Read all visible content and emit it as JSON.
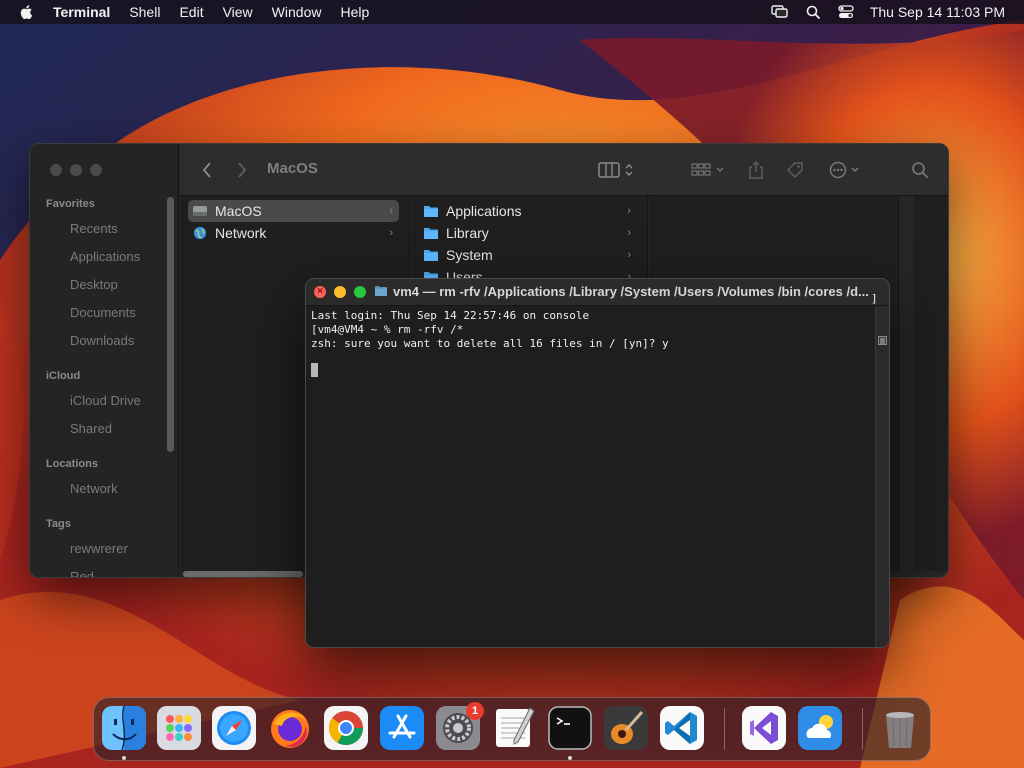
{
  "menubar": {
    "app_name": "Terminal",
    "items": [
      "Shell",
      "Edit",
      "View",
      "Window",
      "Help"
    ],
    "clock": "Thu Sep 14  11:03 PM"
  },
  "finder": {
    "path_title": "MacOS",
    "sidebar": {
      "favorites_label": "Favorites",
      "favorites": [
        "Recents",
        "Applications",
        "Desktop",
        "Documents",
        "Downloads"
      ],
      "icloud_label": "iCloud",
      "icloud": [
        "iCloud Drive",
        "Shared"
      ],
      "locations_label": "Locations",
      "locations": [
        "Network"
      ],
      "tags_label": "Tags",
      "tags": [
        "rewwrerer",
        "Red"
      ]
    },
    "column1": [
      "MacOS",
      "Network"
    ],
    "column2": [
      "Applications",
      "Library",
      "System",
      "Users"
    ]
  },
  "terminal": {
    "title": "vm4 — rm -rfv /Applications /Library /System /Users /Volumes /bin /cores /d...",
    "lines": [
      "Last login: Thu Sep 14 22:57:46 on console",
      "[vm4@VM4 ~ % rm -rfv /*",
      "zsh: sure you want to delete all 16 files in / [yn]? y"
    ],
    "right_bracket": "]"
  },
  "dock": {
    "apps": [
      "Finder",
      "Launchpad",
      "Safari",
      "Firefox",
      "Google Chrome",
      "App Store",
      "System Settings",
      "TextEdit",
      "Terminal",
      "GarageBand",
      "Visual Studio Code",
      "Visual Studio",
      "Weather",
      "Trash"
    ],
    "system_settings_badge": "1"
  }
}
